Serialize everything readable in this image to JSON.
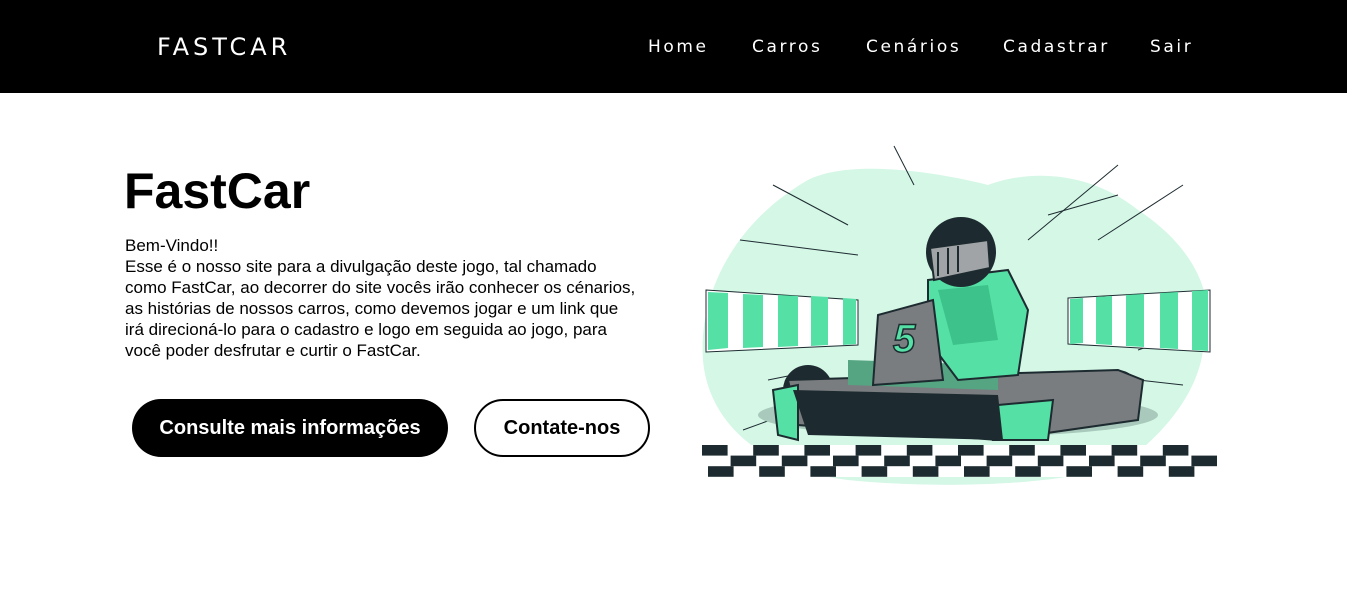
{
  "navbar": {
    "brand": "FASTCAR",
    "links": [
      {
        "label": "Home"
      },
      {
        "label": "Carros"
      },
      {
        "label": "Cenários"
      },
      {
        "label": "Cadastrar"
      },
      {
        "label": "Sair"
      }
    ]
  },
  "hero": {
    "title": "FastCar",
    "paragraph_lines": [
      "Bem-Vindo!!",
      "Esse é o nosso site para a divulgação deste jogo, tal chamado",
      "como FastCar, ao decorrer do site vocês irão conhecer os cénarios,",
      "as histórias de nossos carros, como devemos jogar e um link que",
      "irá direcioná-lo para o cadastro e logo em seguida ao jogo, para",
      "você poder desfrutar e curtir o FastCar."
    ],
    "primary_button": "Consulte mais informações",
    "secondary_button": "Contate-nos"
  },
  "illustration": {
    "kart_number": "5",
    "icon": "go-kart-racer-illustration"
  },
  "colors": {
    "navbar_bg": "#000000",
    "accent_green": "#55e0a6",
    "light_green": "#d4f7e6",
    "dark": "#1d2b30"
  }
}
